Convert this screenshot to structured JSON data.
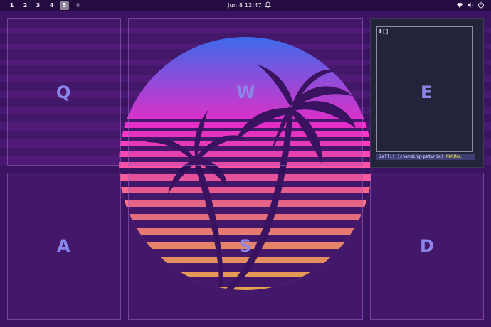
{
  "topbar": {
    "workspaces": [
      {
        "label": "1",
        "state": "normal"
      },
      {
        "label": "2",
        "state": "normal"
      },
      {
        "label": "3",
        "state": "normal"
      },
      {
        "label": "4",
        "state": "normal"
      },
      {
        "label": "5",
        "state": "active"
      },
      {
        "label": "6",
        "state": "inactive"
      }
    ],
    "clock": "Jun 8  12:47",
    "tray_icons": [
      "notification-bell-icon",
      "wifi-icon",
      "volume-icon",
      "power-icon"
    ]
  },
  "tiles": {
    "q": "Q",
    "w": "W",
    "e": "E",
    "a": "A",
    "s": "S",
    "d": "D"
  },
  "terminal": {
    "prompt": "Φ[]",
    "status_session": "Zellij (charming-petunia)",
    "status_mode": "NORMAL"
  },
  "colors": {
    "background": "#3a1460",
    "sun_top": "#2f7bff",
    "sun_mid": "#ff2fd1",
    "sun_bottom": "#ffb43a",
    "tile_letter": "#8b86ea",
    "status_mode": "#e7e04a"
  }
}
